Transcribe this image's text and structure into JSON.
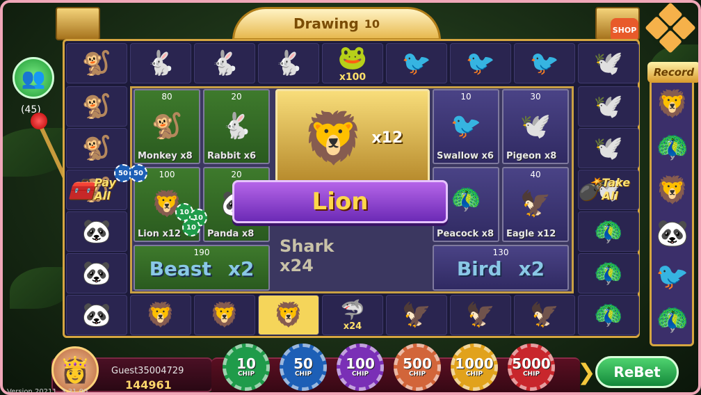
{
  "header": {
    "title": "Drawing",
    "countdown": "10",
    "shop_label": "SHOP"
  },
  "players": {
    "count": "(45)"
  },
  "side_buttons": {
    "pay_all": "Pay All",
    "take_all": "Take All"
  },
  "record": {
    "title": "Record",
    "items": [
      "🦁",
      "🦚",
      "🦁",
      "🐼",
      "🐦",
      "🦚"
    ]
  },
  "ring": {
    "top": [
      "🐒",
      "🐇",
      "🐇",
      "🐇",
      "🐸",
      "🐦",
      "🐦",
      "🐦",
      "🕊️"
    ],
    "top_badge": "x100",
    "left": [
      "🐒",
      "🐒",
      "🐒",
      "🐼",
      "🐼",
      "🐼"
    ],
    "right": [
      "🕊️",
      "🕊️",
      "🕊️",
      "🦚",
      "🦚",
      "🦚"
    ],
    "bottom": [
      "🦁",
      "🦁",
      "🦁",
      "🦈",
      "🦅",
      "🦅",
      "🦅"
    ],
    "bottom_badge": "x24"
  },
  "bets": {
    "monkey": {
      "count": "80",
      "name": "Monkey",
      "mult": "x8",
      "icon": "🐒"
    },
    "rabbit": {
      "count": "20",
      "name": "Rabbit",
      "mult": "x6",
      "icon": "🐇"
    },
    "lion": {
      "count": "100",
      "name": "Lion",
      "mult": "x12",
      "icon": "🦁"
    },
    "panda": {
      "count": "20",
      "name": "Panda",
      "mult": "x8",
      "icon": "🐼"
    },
    "swallow": {
      "count": "10",
      "name": "Swallow",
      "mult": "x6",
      "icon": "🐦"
    },
    "pigeon": {
      "count": "30",
      "name": "Pigeon",
      "mult": "x8",
      "icon": "🕊️"
    },
    "peacock": {
      "count": "",
      "name": "Peacock",
      "mult": "x8",
      "icon": "🦚"
    },
    "eagle": {
      "count": "40",
      "name": "Eagle",
      "mult": "x12",
      "icon": "🦅"
    },
    "beast": {
      "count": "190",
      "name": "Beast",
      "mult": "x2"
    },
    "bird": {
      "count": "130",
      "name": "Bird",
      "mult": "x2"
    },
    "shark": {
      "name": "Shark",
      "mult": "x24"
    }
  },
  "center": {
    "icon": "🦁",
    "mult": "x12",
    "result": "Lion"
  },
  "user": {
    "name": "Guest35004729",
    "coins": "144961",
    "avatar": "👸"
  },
  "version": "Version 20211..3.31.00",
  "chips": [
    {
      "value": "10",
      "label": "CHIP",
      "color": "#1f9b4a"
    },
    {
      "value": "50",
      "label": "CHIP",
      "color": "#1d5fb6"
    },
    {
      "value": "100",
      "label": "CHIP",
      "color": "#7a2fb6"
    },
    {
      "value": "500",
      "label": "CHIP",
      "color": "#d2653a"
    },
    {
      "value": "1000",
      "label": "CHIP",
      "color": "#e1a21c"
    },
    {
      "value": "5000",
      "label": "CHIP",
      "color": "#c8262c"
    }
  ],
  "rebet_label": "ReBet",
  "table_chips": [
    "50",
    "50",
    "10",
    "10",
    "10"
  ]
}
